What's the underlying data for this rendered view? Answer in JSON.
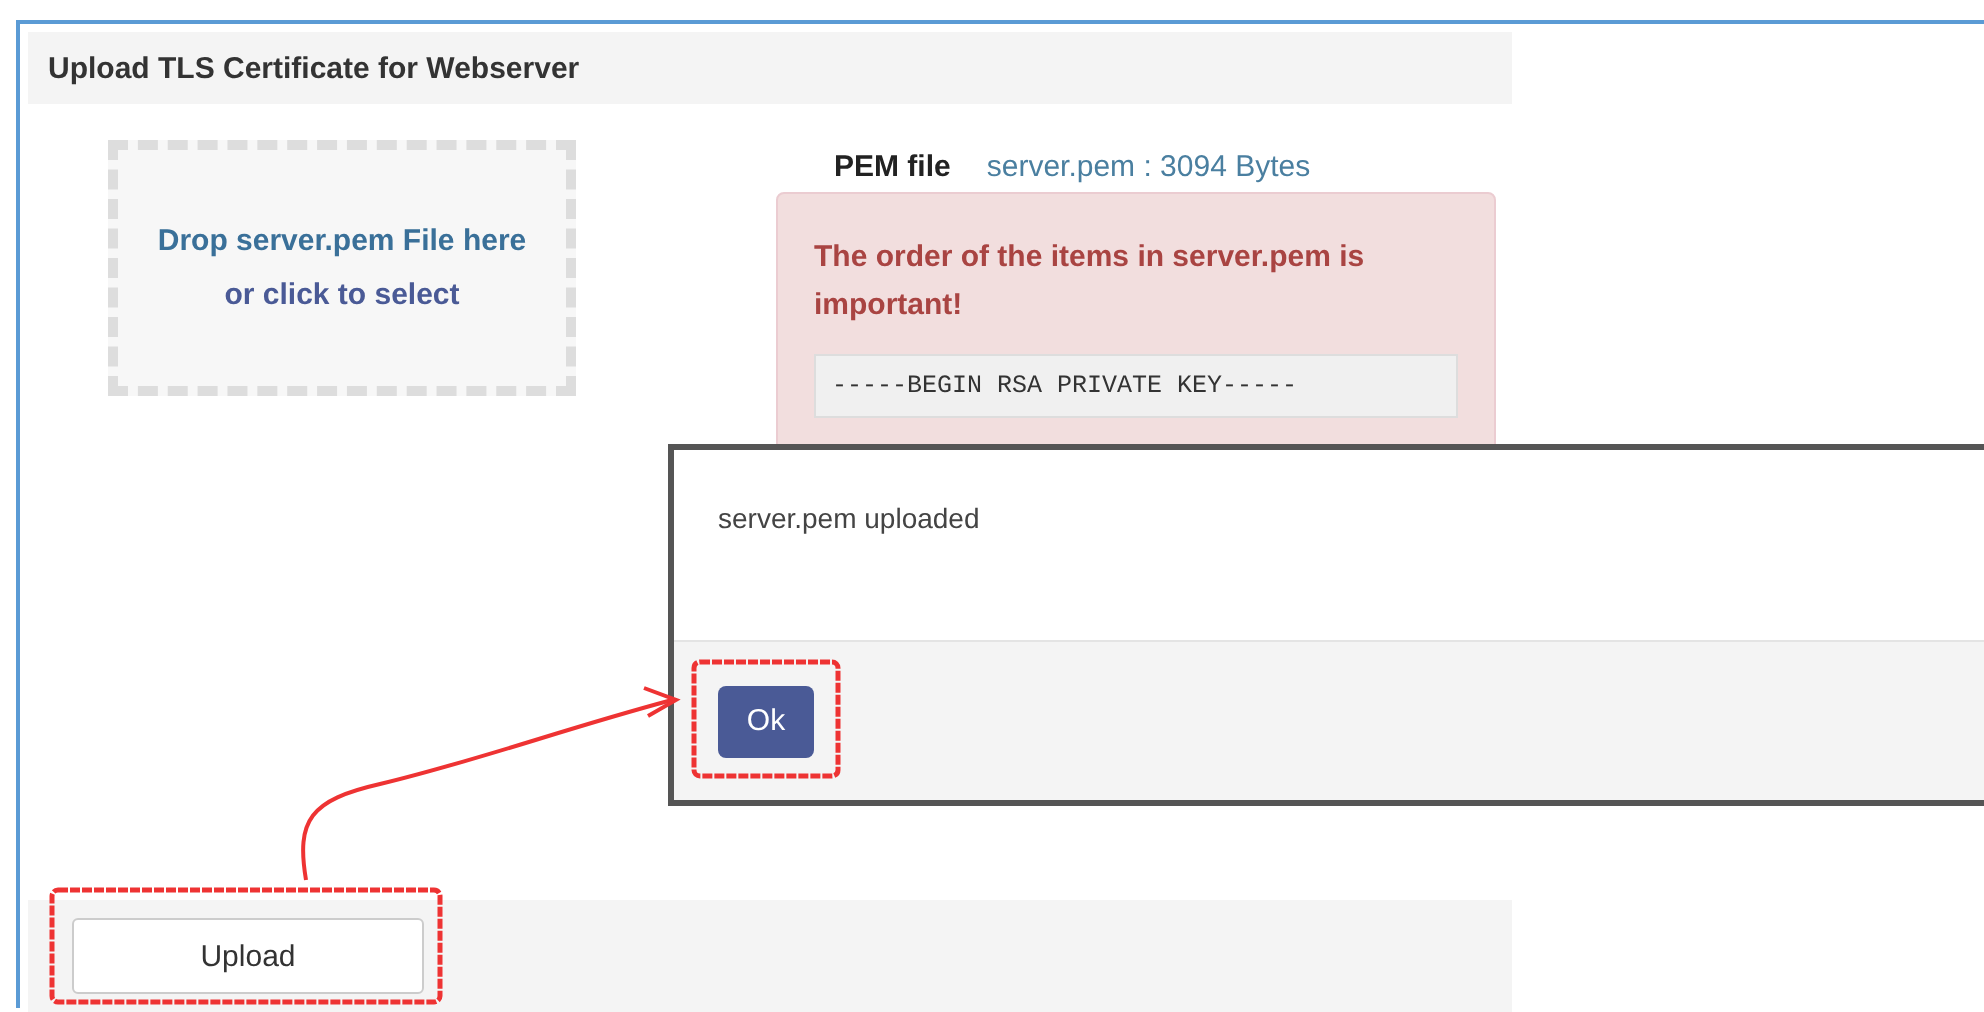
{
  "panel": {
    "title": "Upload TLS Certificate for Webserver"
  },
  "dropzone": {
    "line1": "Drop server.pem File here",
    "line2": "or click to select"
  },
  "pem_file": {
    "label": "PEM file",
    "value": "server.pem : 3094 Bytes"
  },
  "alert": {
    "message": "The order of the items in server.pem is important!",
    "code": "-----BEGIN RSA PRIVATE KEY-----"
  },
  "footer": {
    "button": "Upload"
  },
  "dialog": {
    "message": "server.pem uploaded",
    "button": "Ok"
  }
}
